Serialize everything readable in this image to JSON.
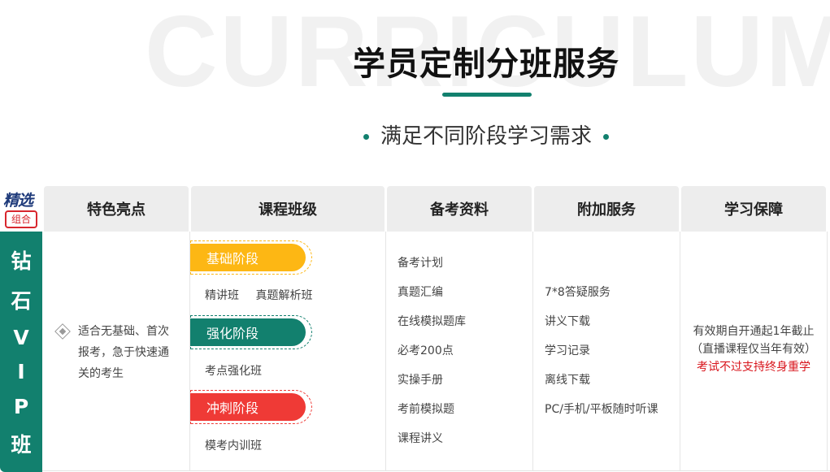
{
  "hero": {
    "bg_word": "CURRICULUM",
    "title": "学员定制分班服务",
    "subtitle": "满足不同阶段学习需求"
  },
  "badge": {
    "top": "精选",
    "bottom": "组合"
  },
  "table": {
    "headers": [
      "特色亮点",
      "课程班级",
      "备考资料",
      "附加服务",
      "学习保障"
    ],
    "row_label_chars": [
      "钻",
      "石",
      "V",
      "I",
      "P",
      "班"
    ],
    "feature": "适合无基础、首次报考，急于快速通关的考生",
    "stages": [
      {
        "label": "基础阶段",
        "color": "#fdb714",
        "items": [
          "精讲班",
          "真题解析班"
        ]
      },
      {
        "label": "强化阶段",
        "color": "#12806e",
        "items": [
          "考点强化班"
        ]
      },
      {
        "label": "冲刺阶段",
        "color": "#ef3a36",
        "items": [
          "模考内训班"
        ]
      }
    ],
    "materials": [
      "备考计划",
      "真题汇编",
      "在线模拟题库",
      "必考200点",
      "实操手册",
      "考前模拟题",
      "课程讲义"
    ],
    "services": [
      "7*8答疑服务",
      "讲义下载",
      "学习记录",
      "离线下载",
      "PC/手机/平板随时听课"
    ],
    "guarantee": {
      "line1": "有效期自开通起1年截止",
      "line2": "（直播课程仅当年有效）",
      "line3": "考试不过支持终身重学"
    }
  }
}
